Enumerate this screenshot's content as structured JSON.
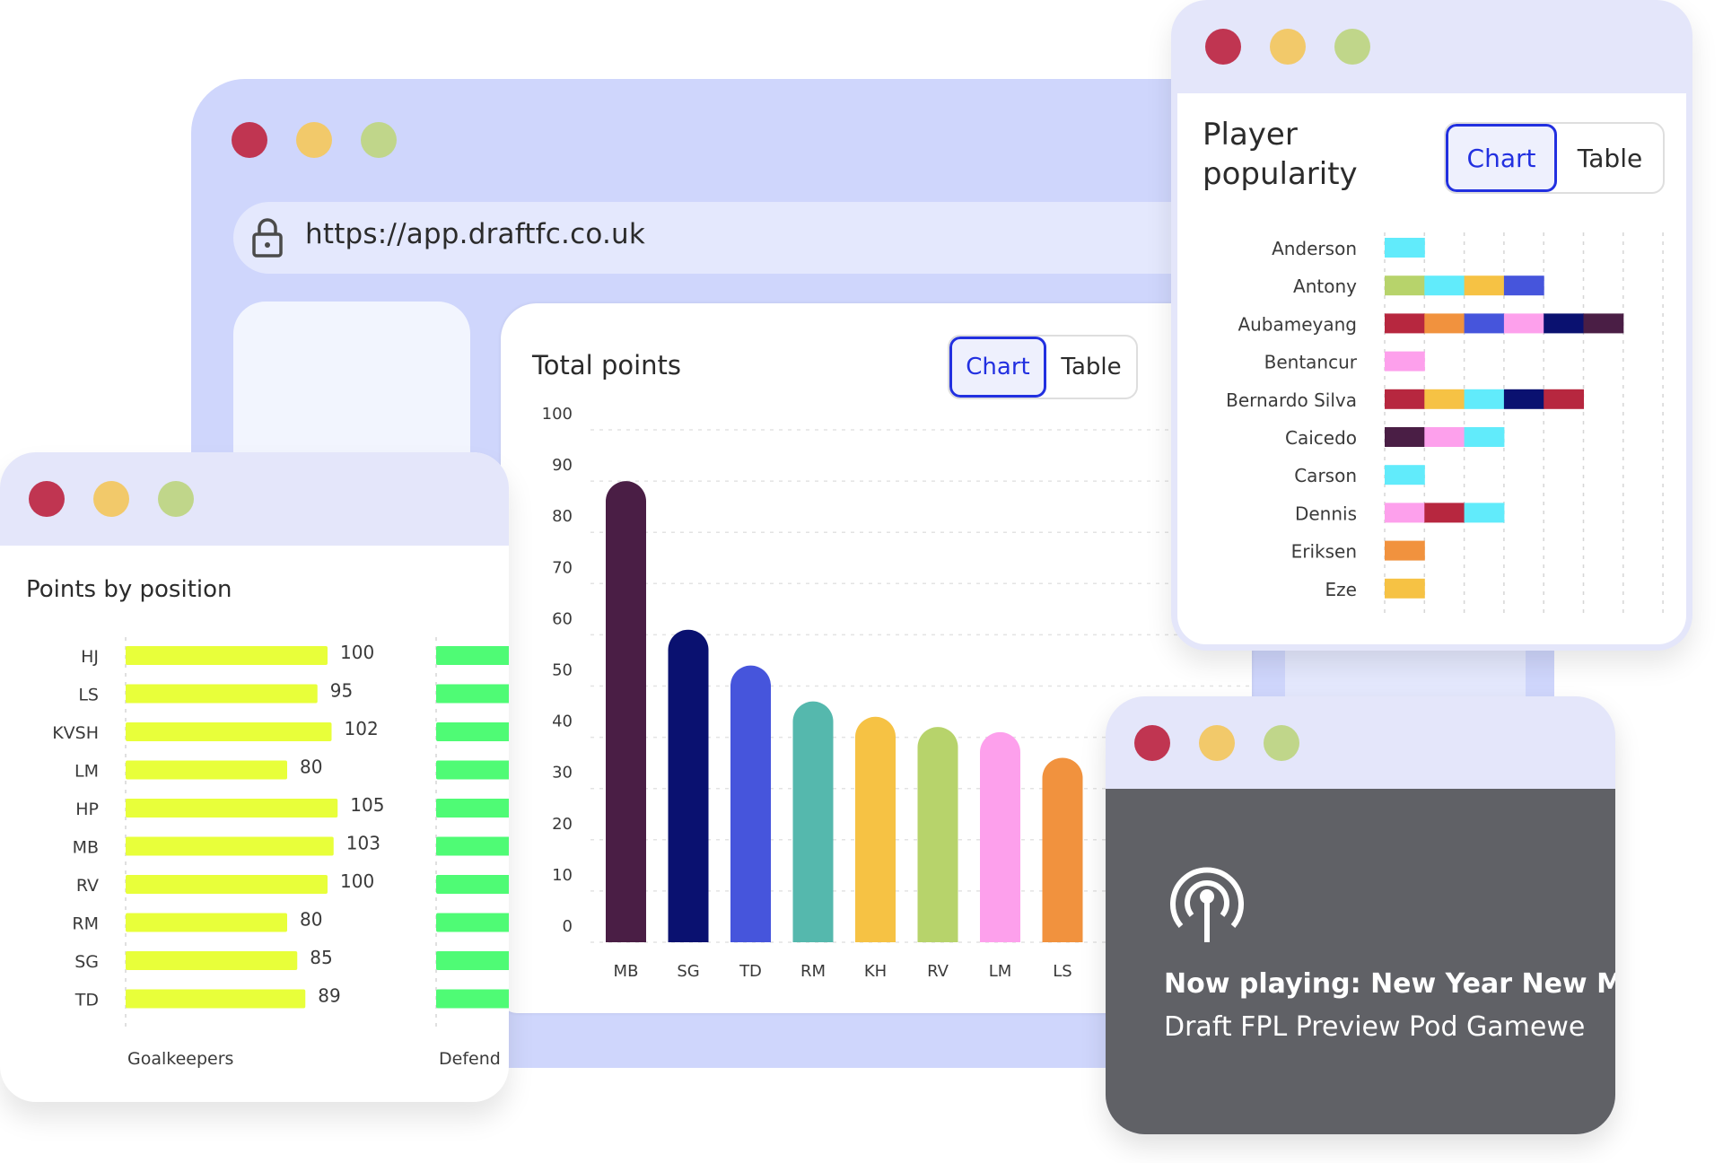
{
  "main_browser": {
    "url": "https://app.draftfc.co.uk",
    "total_points": {
      "title": "Total points",
      "toggle": {
        "chart_label": "Chart",
        "table_label": "Table",
        "active": "Chart"
      }
    }
  },
  "points_by_position": {
    "title": "Points by position"
  },
  "player_popularity": {
    "title_line1": "Player",
    "title_line2": "popularity",
    "toggle": {
      "chart_label": "Chart",
      "table_label": "Table",
      "active": "Chart"
    }
  },
  "now_playing": {
    "icon": "podcast-icon",
    "title": "Now playing: New Year New M",
    "subtitle": "Draft FPL Preview Pod Gamewe"
  },
  "colors": {
    "traffic_red": "#c03551",
    "traffic_yellow": "#f2c96a",
    "traffic_green": "#c0d68a",
    "accent_blue": "#2230e0"
  },
  "chart_data": [
    {
      "type": "bar",
      "title": "Total points",
      "categories": [
        "MB",
        "SG",
        "TD",
        "RM",
        "KH",
        "RV",
        "LM",
        "LS"
      ],
      "values": [
        90,
        61,
        54,
        47,
        44,
        42,
        41,
        36
      ],
      "colors": [
        "#4a1e45",
        "#0a1170",
        "#4655dc",
        "#55b8ad",
        "#f6c244",
        "#b7d36b",
        "#fda0ec",
        "#f1923e"
      ],
      "yticks": [
        0,
        10,
        20,
        30,
        40,
        50,
        60,
        70,
        80,
        90,
        100
      ],
      "ylim": [
        0,
        100
      ],
      "xlabel": "",
      "ylabel": "",
      "grid": true
    },
    {
      "type": "bar",
      "orientation": "horizontal",
      "title": "Points by position",
      "categories": [
        "HJ",
        "LS",
        "KVSH",
        "LM",
        "HP",
        "MB",
        "RV",
        "RM",
        "SG",
        "TD"
      ],
      "series": [
        {
          "name": "Goalkeepers",
          "color": "#e8ff3a",
          "values": [
            100,
            95,
            102,
            80,
            105,
            103,
            100,
            80,
            85,
            89
          ]
        },
        {
          "name": "Defend",
          "color": "#4ffb75",
          "values": []
        }
      ]
    },
    {
      "type": "bar",
      "orientation": "horizontal",
      "stacked": true,
      "title": "Player popularity",
      "categories": [
        "Anderson",
        "Antony",
        "Aubameyang",
        "Bentancur",
        "Bernardo Silva",
        "Caicedo",
        "Carson",
        "Dennis",
        "Eriksen",
        "Eze"
      ],
      "segments": [
        [
          "#61ebfb"
        ],
        [
          "#b7d36b",
          "#61ebfb",
          "#f6c244",
          "#4655dc"
        ],
        [
          "#b7273f",
          "#f1923e",
          "#4655dc",
          "#fda0ec",
          "#0a1170",
          "#4a1e45"
        ],
        [
          "#fda0ec"
        ],
        [
          "#b7273f",
          "#f6c244",
          "#61ebfb",
          "#0a1170",
          "#b7273f"
        ],
        [
          "#4a1e45",
          "#fda0ec",
          "#61ebfb"
        ],
        [
          "#61ebfb"
        ],
        [
          "#fda0ec",
          "#b7273f",
          "#61ebfb"
        ],
        [
          "#f1923e"
        ],
        [
          "#f6c244"
        ]
      ],
      "values": [
        1,
        4,
        6,
        1,
        5,
        3,
        1,
        3,
        1,
        1
      ],
      "xlim": [
        0,
        7
      ],
      "grid": true
    }
  ]
}
